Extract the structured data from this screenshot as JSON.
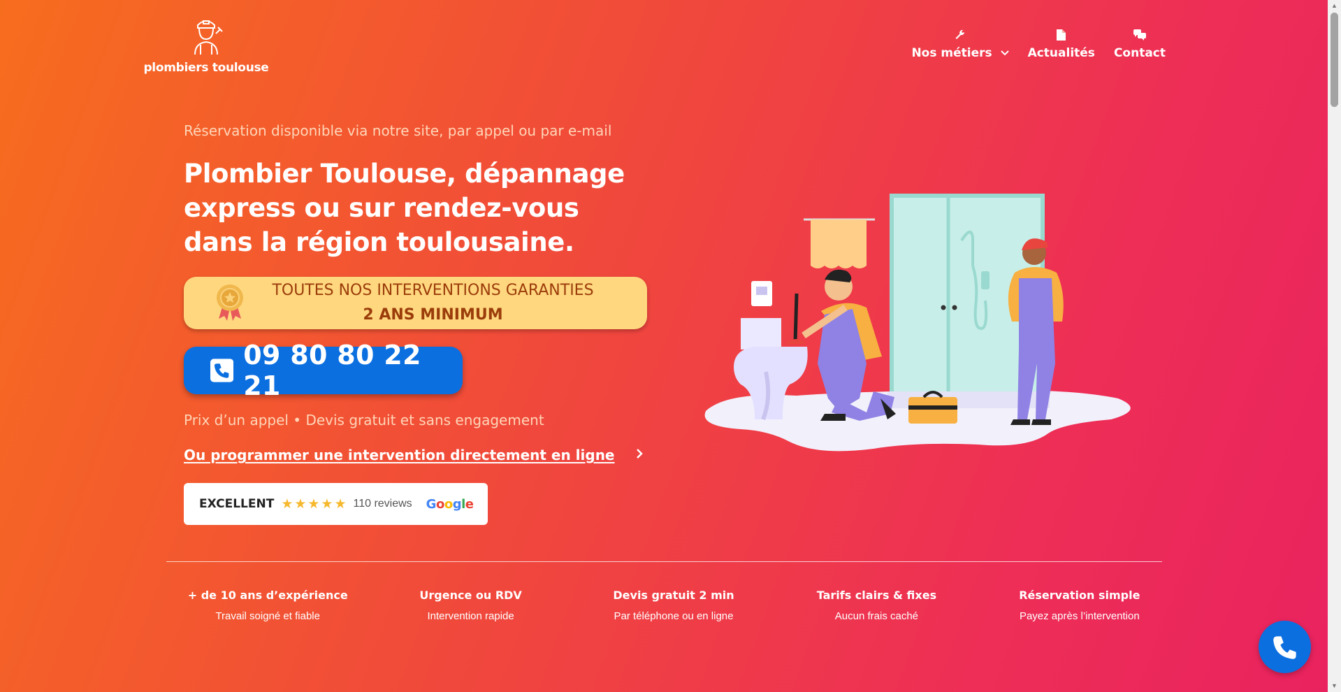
{
  "header": {
    "logo_text": "plombiers toulouse",
    "nav": [
      {
        "label": "Nos métiers",
        "icon": "wrench-icon"
      },
      {
        "label": "Actualités",
        "icon": "document-icon"
      },
      {
        "label": "Contact",
        "icon": "chat-icon"
      }
    ]
  },
  "hero": {
    "kicker": "Réservation disponible via notre site, par appel ou par e-mail",
    "headline": "Plombier Toulouse, dépannage express ou sur rendez-vous dans la région toulousaine.",
    "guarantee_line1": "TOUTES NOS INTERVENTIONS GARANTIES",
    "guarantee_line2": "2 ANS MINIMUM",
    "phone": "09 80 80 22 21",
    "price_note": "Prix d’un appel • Devis gratuit et sans engagement",
    "schedule_link": "Ou programmer une intervention directement en ligne"
  },
  "reviews": {
    "rating_label": "EXCELLENT",
    "stars": "★★★★★",
    "count": "110 reviews",
    "provider": "Google"
  },
  "features": [
    {
      "title": "+ de 10 ans d’expérience",
      "subtitle": "Travail soigné et fiable"
    },
    {
      "title": "Urgence ou RDV",
      "subtitle": "Intervention rapide"
    },
    {
      "title": "Devis gratuit 2 min",
      "subtitle": "Par téléphone ou en ligne"
    },
    {
      "title": "Tarifs clairs & fixes",
      "subtitle": "Aucun frais caché"
    },
    {
      "title": "Réservation simple",
      "subtitle": "Payez après l’intervention"
    }
  ],
  "colors": {
    "gradient_start": "#f76d1e",
    "gradient_end": "#e9225f",
    "phone_button": "#0b6fe0",
    "guarantee_bg": "#ffd77f",
    "guarantee_text": "#9b3d0b"
  }
}
